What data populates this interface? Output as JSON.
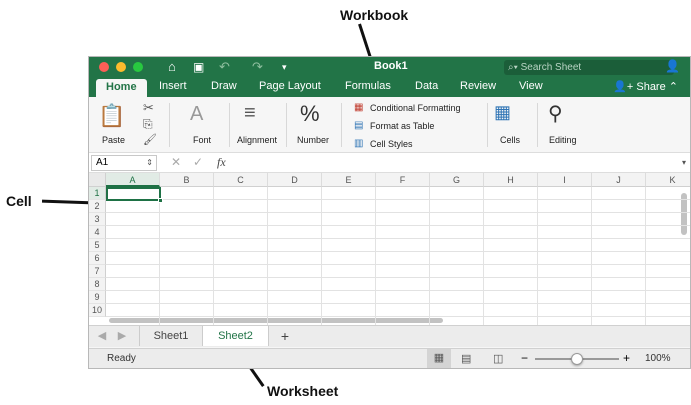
{
  "annotations": {
    "workbook": "Workbook",
    "cell": "Cell",
    "worksheet": "Worksheet"
  },
  "window": {
    "title": "Book1",
    "search_placeholder": "Search Sheet",
    "tabs": [
      "Home",
      "Insert",
      "Draw",
      "Page Layout",
      "Formulas",
      "Data",
      "Review",
      "View"
    ],
    "share_label": "Share"
  },
  "ribbon": {
    "paste": "Paste",
    "font": "Font",
    "alignment": "Alignment",
    "number": "Number",
    "conditional_formatting": "Conditional Formatting",
    "format_as_table": "Format as Table",
    "cell_styles": "Cell Styles",
    "cells": "Cells",
    "editing": "Editing"
  },
  "formula_bar": {
    "name_box": "A1",
    "fx": "fx",
    "value": ""
  },
  "grid": {
    "columns": [
      "A",
      "B",
      "C",
      "D",
      "E",
      "F",
      "G",
      "H",
      "I",
      "J",
      "K"
    ],
    "rows": [
      "1",
      "2",
      "3",
      "4",
      "5",
      "6",
      "7",
      "8",
      "9",
      "10"
    ],
    "selected_cell": "A1"
  },
  "sheets": {
    "tabs": [
      "Sheet1",
      "Sheet2"
    ],
    "active": "Sheet2",
    "add": "+"
  },
  "status": {
    "text": "Ready",
    "zoom": "100%",
    "zoom_minus": "−",
    "zoom_plus": "+",
    "zoom_level": 0.5
  },
  "colors": {
    "accent": "#227447",
    "selection": "#1e7145"
  }
}
